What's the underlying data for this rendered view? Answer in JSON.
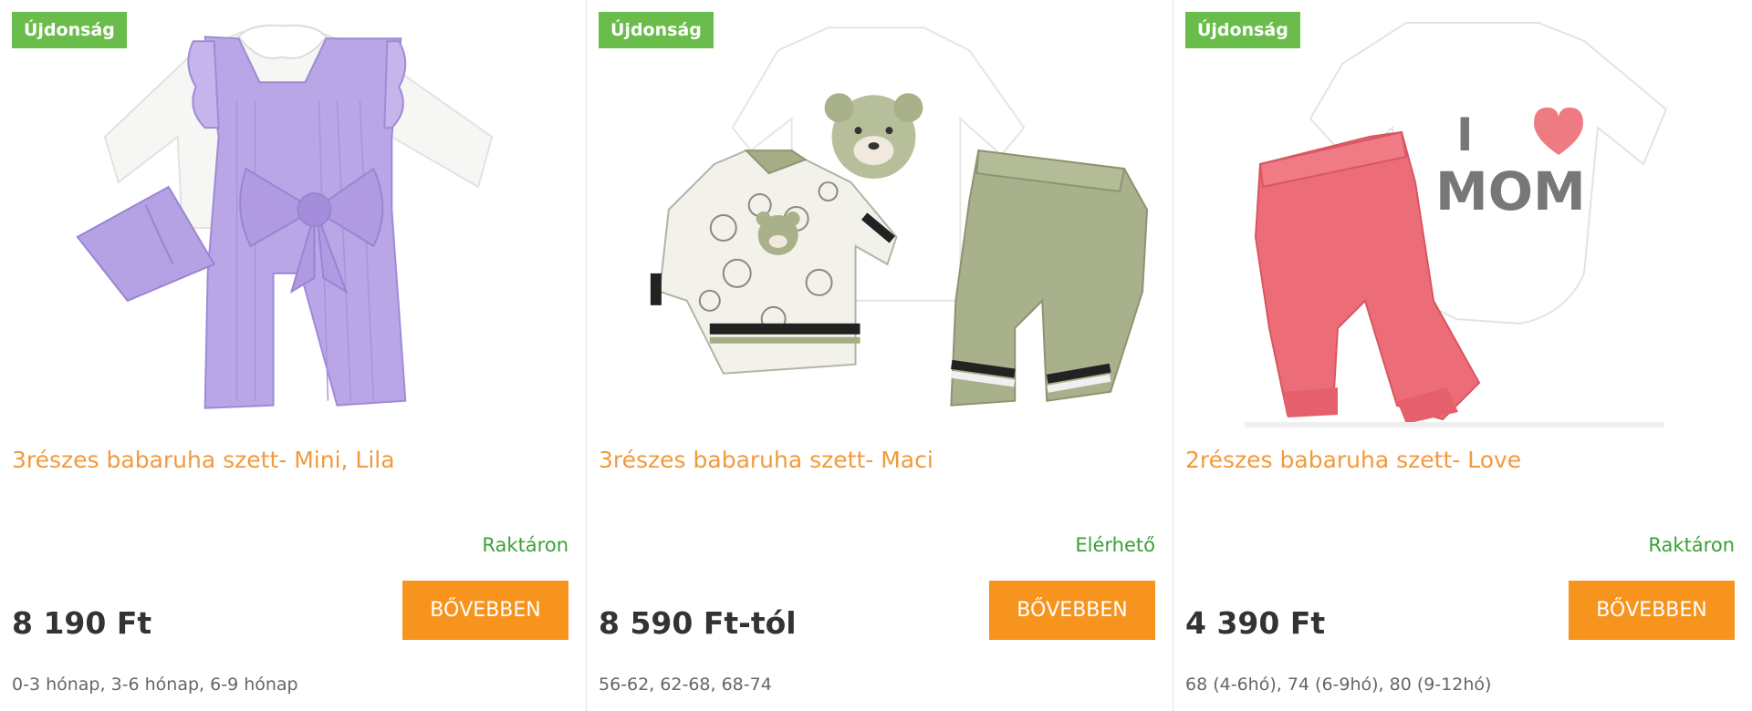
{
  "products": [
    {
      "badge": "Újdonság",
      "title": "3részes babaruha szett- Mini, Lila",
      "stock": "Raktáron",
      "price": "8 190 Ft",
      "button": "BŐVEBBEN",
      "sizes": "0-3 hónap, 3-6 hónap, 6-9 hónap"
    },
    {
      "badge": "Újdonság",
      "title": "3részes babaruha szett- Maci",
      "stock": "Elérhető",
      "price": "8 590 Ft-tól",
      "button": "BŐVEBBEN",
      "sizes": "56-62, 62-68, 68-74"
    },
    {
      "badge": "Újdonság",
      "title": "2részes babaruha szett- Love",
      "stock": "Raktáron",
      "price": "4 390 Ft",
      "button": "BŐVEBBEN",
      "sizes": "68 (4-6hó), 74 (6-9hó), 80 (9-12hó)"
    }
  ],
  "print_text": {
    "line1": "I",
    "line2": "MOM"
  },
  "colors": {
    "badge": "#6bbd4b",
    "title": "#f29a3c",
    "stock": "#3aa038",
    "button": "#f7941d",
    "price": "#333333"
  }
}
